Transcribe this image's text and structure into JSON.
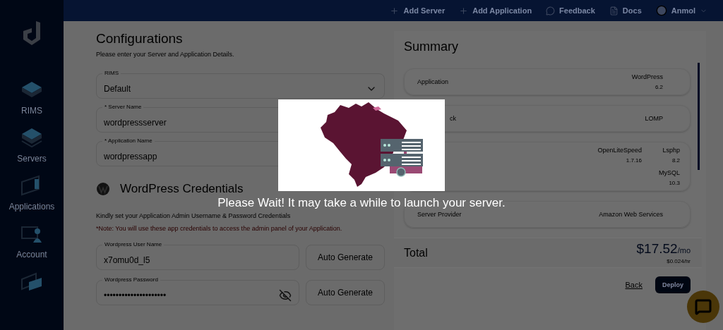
{
  "topbar": {
    "actions": [
      {
        "kind": "add",
        "label": "Add Server"
      },
      {
        "kind": "add",
        "label": "Add Application"
      },
      {
        "kind": "feedback",
        "label": "Feedback"
      },
      {
        "kind": "docs",
        "label": "Docs"
      }
    ],
    "user": "Anmol"
  },
  "sidebar": {
    "items": [
      {
        "kind": "rims",
        "label": "RIMS"
      },
      {
        "kind": "servers",
        "label": "Servers"
      },
      {
        "kind": "applications",
        "label": "Applications"
      },
      {
        "kind": "account",
        "label": "Account"
      },
      {
        "kind": "support"
      }
    ]
  },
  "configurations": {
    "title": "Configurations",
    "subtitle": "Please enter your Server and Application Details.",
    "fields": [
      {
        "kind": "select",
        "label": "RIMS",
        "value": "Default"
      },
      {
        "kind": "text",
        "label": "* Server Name",
        "value": "wordpressserver"
      },
      {
        "kind": "text",
        "label": "* Application Name",
        "value": "wordpressapp"
      }
    ]
  },
  "credentials": {
    "title": "WordPress Credentials",
    "description": "Kindly set your Application Admin Username & Password Credentials",
    "note": "*Note: You will use these app credentials to access the admin panel of your Application.",
    "fields": [
      {
        "kind": "text",
        "label": "Wordpress User Name",
        "value": "x7omu0d_l5",
        "button": "Auto Generate"
      },
      {
        "kind": "password",
        "label": "Wordpress Password",
        "value": "•••••••••••••••••••••",
        "button": "Auto Generate"
      }
    ]
  },
  "summary": {
    "title": "Summary",
    "rows": [
      {
        "label": "Application",
        "items": [
          {
            "name": "WordPress",
            "version": "6.2"
          }
        ]
      },
      {
        "label": "ck",
        "items": [
          {
            "name": "LOMP"
          }
        ]
      },
      {
        "items": [
          {
            "name": "OpenLiteSpeed",
            "version": "1.7.16"
          },
          {
            "name": "Lsphp",
            "version": "8.2"
          },
          {
            "name": "MySQL",
            "version": "10.3"
          }
        ]
      },
      {
        "label": "Server Provider",
        "items": [
          {
            "name": "Amazon Web Services"
          }
        ]
      }
    ],
    "total": {
      "label": "Total",
      "price": "$17.52",
      "unit": "/mo",
      "hourly": "$0.024/hr"
    },
    "back": "Back",
    "deploy": "Deploy"
  },
  "overlay": {
    "message": "Please Wait! It may take a while to launch your server."
  }
}
